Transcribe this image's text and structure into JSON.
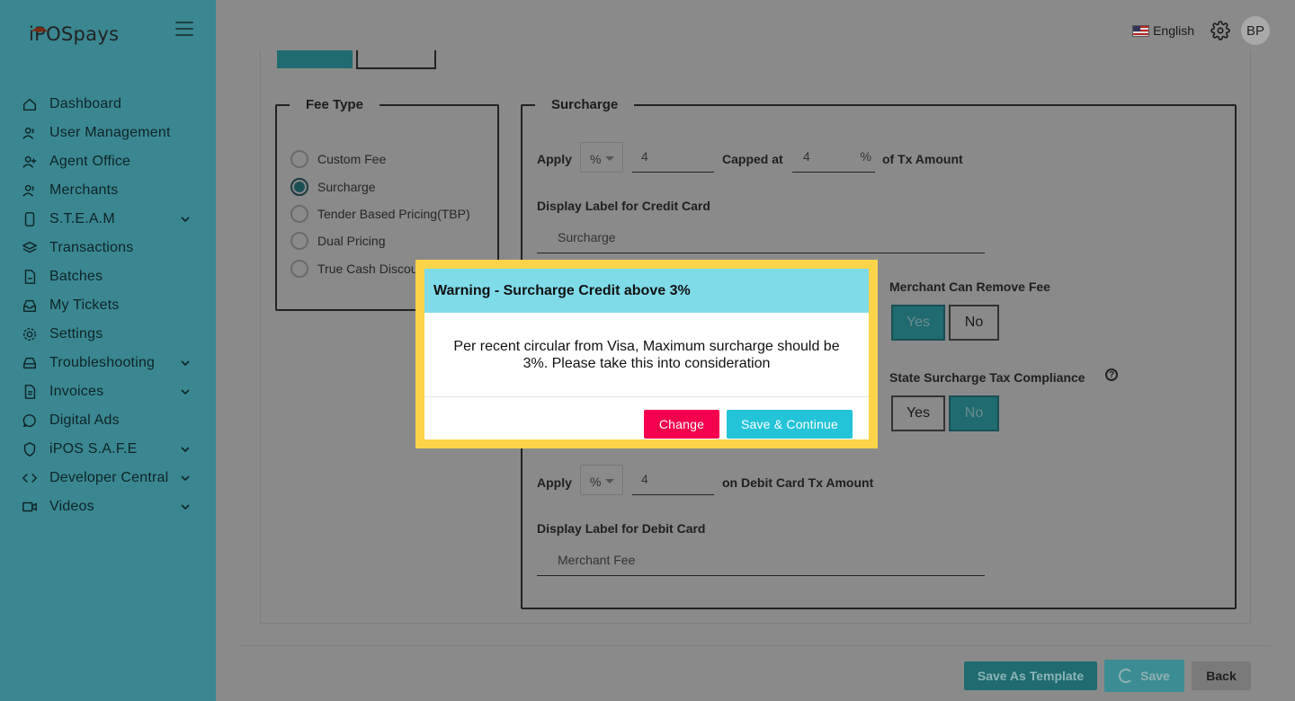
{
  "brand": {
    "logo_text": "iPOSpays"
  },
  "topbar": {
    "language": "English",
    "avatar_initials": "BP"
  },
  "sidebar": {
    "items": [
      {
        "label": "Dashboard",
        "icon": "home-icon",
        "expandable": false
      },
      {
        "label": "User Management",
        "icon": "users-icon",
        "expandable": false
      },
      {
        "label": "Agent Office",
        "icon": "user-plus-icon",
        "expandable": false
      },
      {
        "label": "Merchants",
        "icon": "users-icon",
        "expandable": false
      },
      {
        "label": "S.T.E.A.M",
        "icon": "mobile-icon",
        "expandable": true
      },
      {
        "label": "Transactions",
        "icon": "layers-icon",
        "expandable": false
      },
      {
        "label": "Batches",
        "icon": "file-icon",
        "expandable": false
      },
      {
        "label": "My Tickets",
        "icon": "inbox-icon",
        "expandable": false
      },
      {
        "label": "Settings",
        "icon": "gear-icon",
        "expandable": false
      },
      {
        "label": "Troubleshooting",
        "icon": "drive-icon",
        "expandable": true
      },
      {
        "label": "Invoices",
        "icon": "document-icon",
        "expandable": true
      },
      {
        "label": "Digital Ads",
        "icon": "chat-icon",
        "expandable": false
      },
      {
        "label": "iPOS S.A.F.E",
        "icon": "shield-icon",
        "expandable": true
      },
      {
        "label": "Developer Central",
        "icon": "code-icon",
        "expandable": true
      },
      {
        "label": "Videos",
        "icon": "video-icon",
        "expandable": true
      }
    ]
  },
  "fee_type": {
    "legend": "Fee Type",
    "options": [
      "Custom Fee",
      "Surcharge",
      "Tender Based Pricing(TBP)",
      "Dual Pricing",
      "True Cash Discou"
    ],
    "selected": "Surcharge"
  },
  "surcharge": {
    "legend": "Surcharge",
    "apply_label": "Apply",
    "credit_unit": "%",
    "credit_value": "4",
    "capped_label": "Capped at",
    "capped_value": "4",
    "capped_unit": "%",
    "of_tx_label": "of Tx Amount",
    "credit_display_label": "Display Label for Credit Card",
    "credit_display_value": "Surcharge",
    "merchant_remove_label": "Merchant Can Remove Fee",
    "merchant_remove_yes": "Yes",
    "merchant_remove_no": "No",
    "merchant_remove_selected": "Yes",
    "state_tax_label": "State Surcharge Tax Compliance",
    "state_tax_yes": "Yes",
    "state_tax_no": "No",
    "state_tax_selected": "No",
    "debit_apply_label": "Apply",
    "debit_unit": "%",
    "debit_value": "4",
    "debit_tx_label": "on Debit Card Tx Amount",
    "debit_display_label": "Display Label for Debit Card",
    "debit_display_value": "Merchant Fee"
  },
  "footer": {
    "save_template": "Save As Template",
    "save": "Save",
    "back": "Back"
  },
  "modal": {
    "title": "Warning - Surcharge Credit above 3%",
    "message": "Per recent circular from Visa, Maximum surcharge should be 3%. Please take this into consideration",
    "change_button": "Change",
    "save_continue_button": "Save & Continue"
  },
  "colors": {
    "sidebar": "#3a8791",
    "modal_header": "#80dbe9",
    "modal_highlight": "#fbd44a",
    "change_button": "#f5004e",
    "save_continue_button": "#23c4d8"
  }
}
